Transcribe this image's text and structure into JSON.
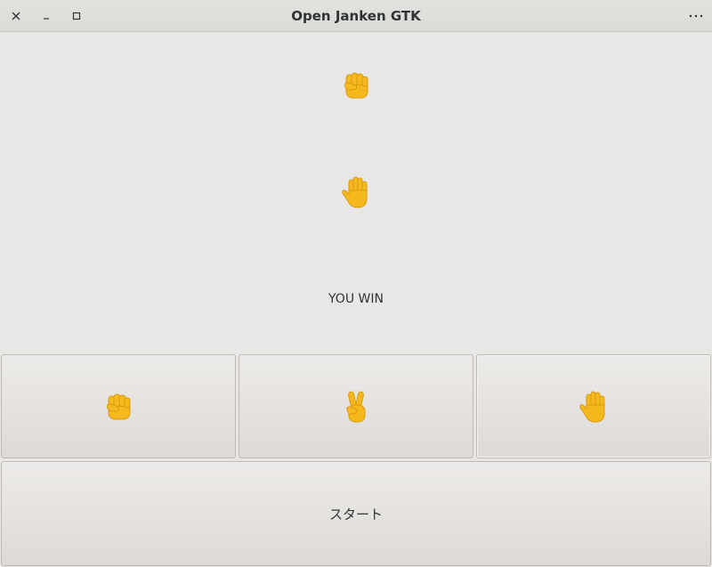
{
  "window": {
    "title": "Open Janken GTK",
    "close_icon": "close-icon",
    "minimize_icon": "minimize-icon",
    "maximize_icon": "maximize-icon",
    "menu_icon": "more-horizontal-icon"
  },
  "display": {
    "computer_hand_icon": "raised-fist-icon",
    "player_hand_icon": "raised-hand-icon",
    "result_text": "YOU WIN"
  },
  "choices": [
    {
      "name": "rock",
      "icon": "raised-fist-icon"
    },
    {
      "name": "scissors",
      "icon": "victory-hand-icon"
    },
    {
      "name": "paper",
      "icon": "raised-hand-icon"
    }
  ],
  "start_button": {
    "label": "スタート"
  },
  "colors": {
    "emoji": "#f6b91d",
    "background": "#e8e7e6"
  }
}
